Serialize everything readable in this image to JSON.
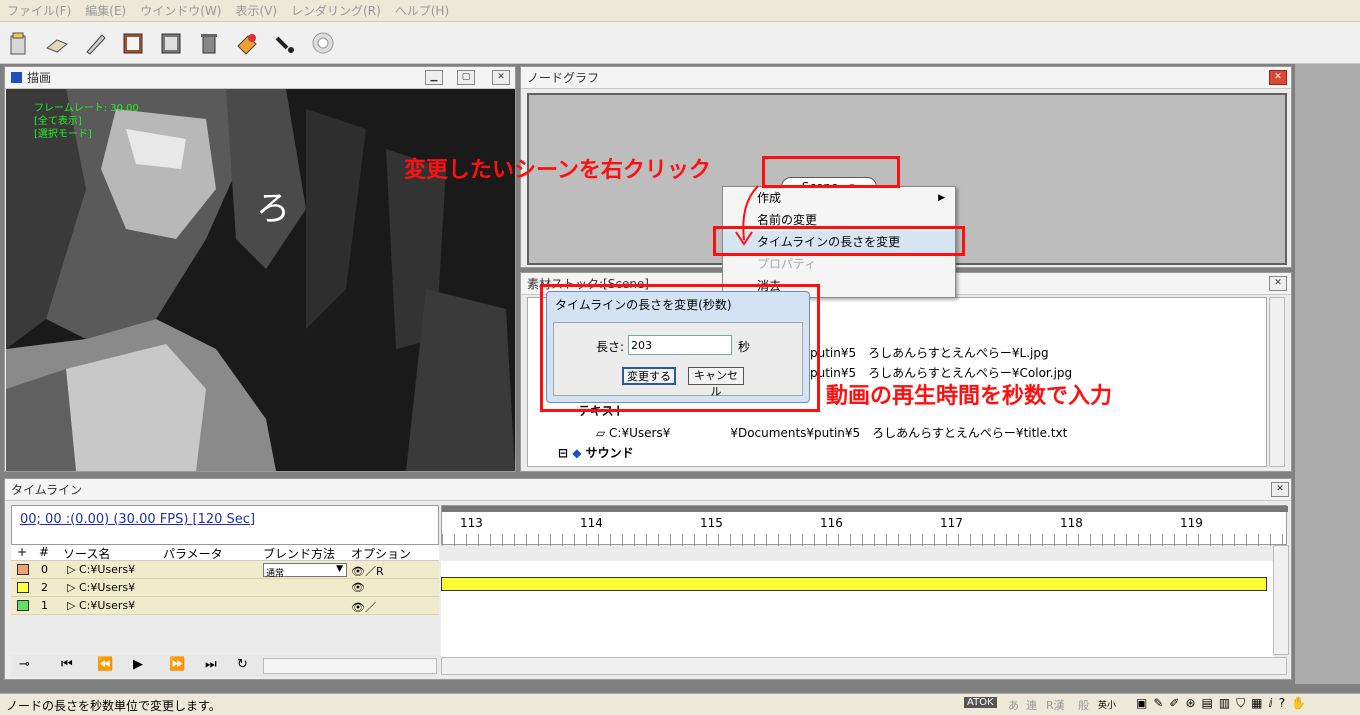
{
  "menu": [
    "ファイル(F)",
    "編集(E)",
    "ウインドウ(W)",
    "表示(V)",
    "レンダリング(R)",
    "ヘルプ(H)"
  ],
  "toolbar_icons": [
    "new-icon",
    "open-icon",
    "pen-icon",
    "book-icon",
    "export-icon",
    "trash-icon",
    "paint-icon",
    "plug-icon",
    "camera-icon"
  ],
  "draw_panel": {
    "title": "描画",
    "osd_lines": [
      "フレームレート: 30.00",
      "[全て表示]",
      "[選択モード]"
    ],
    "canvas_text": "ろ"
  },
  "node_panel": {
    "title": "ノードグラフ",
    "node_label": "Scene"
  },
  "context_menu": {
    "items": [
      {
        "label": "作成",
        "submenu": true
      },
      {
        "label": "名前の変更"
      },
      {
        "label": "タイムラインの長さを変更",
        "selected": true
      },
      {
        "label": "プロパティ",
        "disabled": true
      },
      {
        "label": "消去"
      }
    ]
  },
  "stock_panel": {
    "title": "素材ストック:[Scene]",
    "rows": [
      "putin¥5　ろしあんらすとえんぺらー¥L.jpg",
      "putin¥5　ろしあんらすとえんぺらー¥Color.jpg",
      "テキスト",
      "C:¥Users¥",
      "¥Documents¥putin¥5　ろしあんらすとえんぺらー¥title.txt",
      "サウンド"
    ]
  },
  "dialog": {
    "title": "タイムラインの長さを変更(秒数)",
    "label": "長さ:",
    "value": "203",
    "unit": "秒",
    "ok": "変更する",
    "cancel": "キャンセル"
  },
  "annotations": {
    "right_click": "変更したいシーンを右クリック",
    "input_seconds": "動画の再生時間を秒数で入力"
  },
  "timeline": {
    "title": "タイムライン",
    "timecode": "00; 00 :(0.00) (30.00 FPS) [120 Sec]",
    "ticks": [
      "113",
      "114",
      "115",
      "116",
      "117",
      "118",
      "119"
    ],
    "columns": {
      "plus": "+",
      "num": "#",
      "source": "ソース名",
      "param": "パラメータ",
      "blend": "ブレンド方法",
      "option": "オプション"
    },
    "rows": [
      {
        "color": "#f2a07c",
        "num": "0",
        "source": "▷ C:¥Users¥",
        "blend": "通常",
        "option": "👁／R"
      },
      {
        "color": "#ffff44",
        "num": "2",
        "source": "▷ C:¥Users¥",
        "blend": "",
        "option": "👁"
      },
      {
        "color": "#66dd66",
        "num": "1",
        "source": "▷ C:¥Users¥",
        "blend": "",
        "option": "👁／"
      }
    ]
  },
  "status": {
    "text": "ノードの長さを秒数単位で変更します。",
    "ime": [
      "ATOK",
      "あ",
      "連",
      "R漢",
      "般",
      "英小"
    ]
  }
}
